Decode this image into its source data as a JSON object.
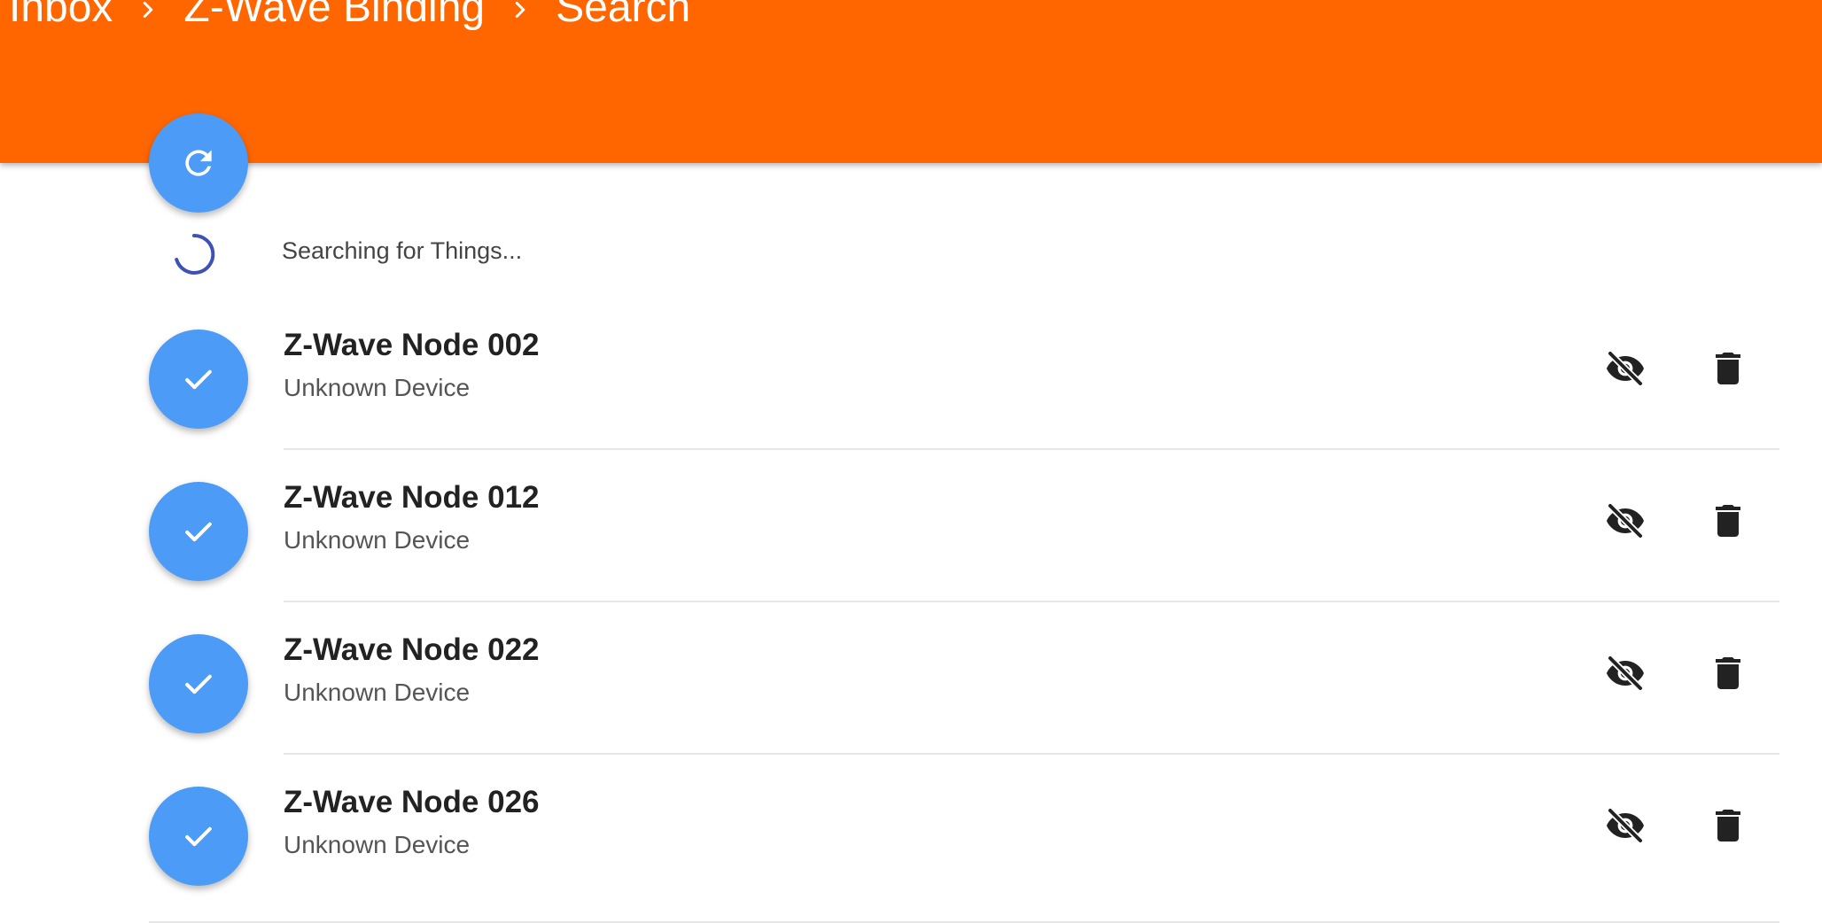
{
  "breadcrumb": {
    "items": [
      "Inbox",
      "Z-Wave Binding",
      "Search"
    ]
  },
  "status": {
    "text": "Searching for Things..."
  },
  "things": [
    {
      "title": "Z-Wave Node 002",
      "subtitle": "Unknown Device"
    },
    {
      "title": "Z-Wave Node 012",
      "subtitle": "Unknown Device"
    },
    {
      "title": "Z-Wave Node 022",
      "subtitle": "Unknown Device"
    },
    {
      "title": "Z-Wave Node 026",
      "subtitle": "Unknown Device"
    }
  ],
  "icons": {
    "refresh": "refresh-icon",
    "approve": "check-icon",
    "ignore": "visibility-off-icon",
    "delete": "trash-icon",
    "breadcrumb_separator": "chevron-right-icon"
  },
  "colors": {
    "header": "#ff6600",
    "fab": "#4c9bf7",
    "spinner": "#3f51b5"
  }
}
